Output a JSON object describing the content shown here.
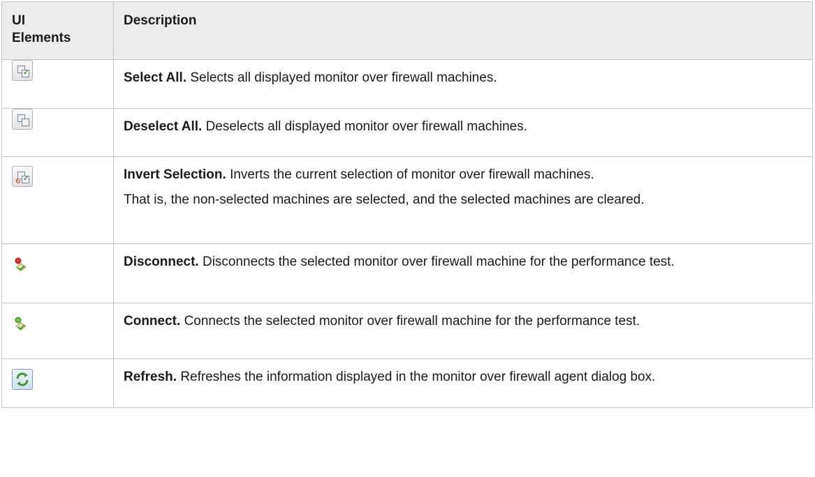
{
  "table": {
    "headers": [
      "UI Elements",
      "Description"
    ],
    "rows": [
      {
        "icon": "select-all-icon",
        "term": "Select All.",
        "description": "Selects all displayed monitor over firewall machines.",
        "extra": ""
      },
      {
        "icon": "deselect-all-icon",
        "term": "Deselect All.",
        "description": "Deselects all displayed monitor over firewall machines.",
        "extra": ""
      },
      {
        "icon": "invert-selection-icon",
        "term": "Invert Selection.",
        "description": "Inverts the current selection of monitor over firewall machines.",
        "extra": "That is, the non-selected machines are selected, and the selected machines are cleared."
      },
      {
        "icon": "disconnect-icon",
        "term": "Disconnect.",
        "description": "Disconnects the selected monitor over firewall machine for the performance test.",
        "extra": ""
      },
      {
        "icon": "connect-icon",
        "term": "Connect.",
        "description": "Connects the selected monitor over firewall machine for the performance test.",
        "extra": ""
      },
      {
        "icon": "refresh-icon",
        "term": "Refresh.",
        "description": "Refreshes the information displayed in the monitor over firewall agent dialog box.",
        "extra": ""
      }
    ]
  }
}
